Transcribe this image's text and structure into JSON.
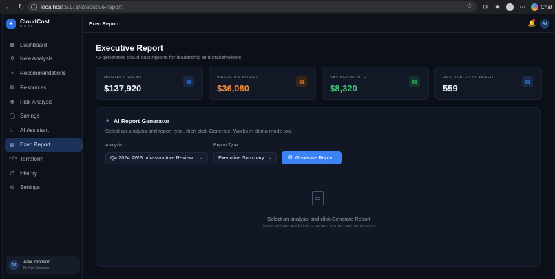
{
  "browser": {
    "url_host": "localhost",
    "url_path": ":5173/executive-report",
    "chat_label": "Chat"
  },
  "sidebar": {
    "brand": "CloudCost",
    "brand_sub": "PULSE",
    "items": [
      {
        "label": "Dashboard",
        "icon": "grid-icon"
      },
      {
        "label": "New Analysis",
        "icon": "search-icon"
      },
      {
        "label": "Recommendations",
        "icon": "lightbulb-icon"
      },
      {
        "label": "Resources",
        "icon": "server-icon"
      },
      {
        "label": "Risk Analysis",
        "icon": "shield-icon"
      },
      {
        "label": "Savings",
        "icon": "piggy-bank-icon"
      },
      {
        "label": "AI Assistant",
        "icon": "chat-icon"
      },
      {
        "label": "Exec Report",
        "icon": "document-icon"
      },
      {
        "label": "Terraform",
        "icon": "code-icon"
      },
      {
        "label": "History",
        "icon": "history-icon"
      },
      {
        "label": "Settings",
        "icon": "gear-icon"
      }
    ],
    "active_index": 7,
    "user": {
      "initials": "AJ",
      "name": "Alex Johnson",
      "role": "FinOps Engineer"
    }
  },
  "header": {
    "title": "Exec Report",
    "avatar_initials": "AJ"
  },
  "page": {
    "title": "Executive Report",
    "subtitle": "AI-generated cloud cost reports for leadership and stakeholders"
  },
  "stats": [
    {
      "label": "MONTHLY SPEND",
      "value": "$137,920",
      "color": "#f3f5f9",
      "icon_color": "#3b82f6"
    },
    {
      "label": "WASTE IDENTIFIED",
      "value": "$36,080",
      "color": "#f08a3c",
      "icon_color": "#f08a3c"
    },
    {
      "label": "SAVINGS/MONTH",
      "value": "$8,320",
      "color": "#3fc47a",
      "icon_color": "#3fc47a"
    },
    {
      "label": "RESOURCES SCANNED",
      "value": "559",
      "color": "#f3f5f9",
      "icon_color": "#3b82f6"
    }
  ],
  "generator": {
    "title": "AI Report Generator",
    "subtitle": "Select an analysis and report type, then click Generate. Works in demo mode too.",
    "analysis_label": "Analysis",
    "analysis_value": "Q4 2024 AWS Infrastructure Review",
    "report_type_label": "Report Type",
    "report_type_value": "Executive Summary",
    "button_label": "Generate Report",
    "empty_message": "Select an analysis and click Generate Report",
    "empty_hint": "Works without an API key — returns a structured demo report"
  }
}
